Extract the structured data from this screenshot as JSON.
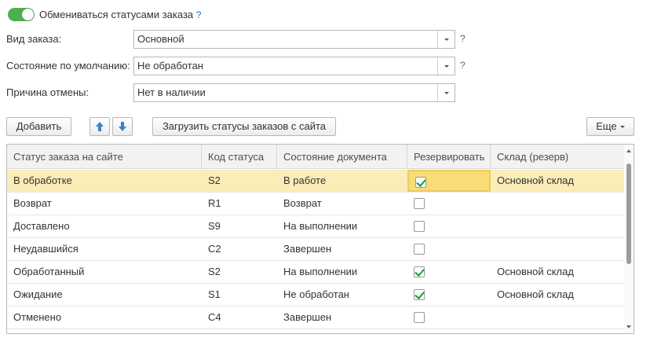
{
  "toggle": {
    "label": "Обмениваться статусами заказа",
    "on": true,
    "help": "?"
  },
  "fields": {
    "order_type": {
      "label": "Вид заказа:",
      "value": "Основной",
      "help": "?"
    },
    "default_state": {
      "label": "Состояние по умолчанию:",
      "value": "Не обработан",
      "help": "?"
    },
    "cancel_reason": {
      "label": "Причина отмены:",
      "value": "Нет в наличии"
    }
  },
  "toolbar": {
    "add_label": "Добавить",
    "up_icon": "arrow-up-icon",
    "down_icon": "arrow-down-icon",
    "load_label": "Загрузить статусы заказов с сайта",
    "more_label": "Еще"
  },
  "table": {
    "columns": [
      "Статус заказа на сайте",
      "Код статуса",
      "Состояние документа",
      "Резервировать",
      "Склад (резерв)"
    ],
    "rows": [
      {
        "status": "В обработке",
        "code": "S2",
        "state": "В работе",
        "reserve": true,
        "warehouse": "Основной склад",
        "selected": true
      },
      {
        "status": "Возврат",
        "code": "R1",
        "state": "Возврат",
        "reserve": false,
        "warehouse": ""
      },
      {
        "status": "Доставлено",
        "code": "S9",
        "state": "На выполнении",
        "reserve": false,
        "warehouse": ""
      },
      {
        "status": "Неудавшийся",
        "code": "C2",
        "state": "Завершен",
        "reserve": false,
        "warehouse": ""
      },
      {
        "status": "Обработанный",
        "code": "S2",
        "state": "На выполнении",
        "reserve": true,
        "warehouse": "Основной склад"
      },
      {
        "status": "Ожидание",
        "code": "S1",
        "state": "Не обработан",
        "reserve": true,
        "warehouse": "Основной склад"
      },
      {
        "status": "Отменено",
        "code": "C4",
        "state": "Завершен",
        "reserve": false,
        "warehouse": ""
      }
    ]
  },
  "colors": {
    "toggle_on": "#4caf50",
    "help": "#2f6fb5",
    "selected_row": "#fbedb8",
    "focus_cell": "#f8dc78",
    "check": "#1a9a3a",
    "arrow": "#3b82c4"
  }
}
